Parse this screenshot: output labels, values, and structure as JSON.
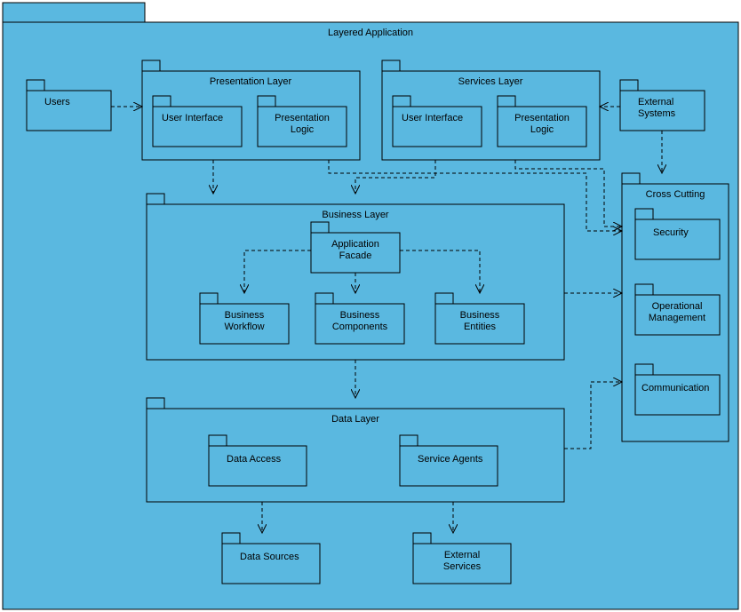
{
  "title": "Layered Application",
  "packages": {
    "users": "Users",
    "externalSystems": "External\nSystems",
    "presentationLayer": "Presentation Layer",
    "servicesLayer": "Services Layer",
    "userInterface1": "User Interface",
    "presentationLogic1": "Presentation\nLogic",
    "userInterface2": "User Interface",
    "presentationLogic2": "Presentation\nLogic",
    "businessLayer": "Business Layer",
    "applicationFacade": "Application\nFacade",
    "businessWorkflow": "Business\nWorkflow",
    "businessComponents": "Business\nComponents",
    "businessEntities": "Business\nEntities",
    "dataLayer": "Data Layer",
    "dataAccess": "Data Access",
    "serviceAgents": "Service Agents",
    "dataSources": "Data Sources",
    "externalServices": "External\nServices",
    "crossCutting": "Cross Cutting",
    "security": "Security",
    "operationalManagement": "Operational\nManagement",
    "communication": "Communication"
  }
}
